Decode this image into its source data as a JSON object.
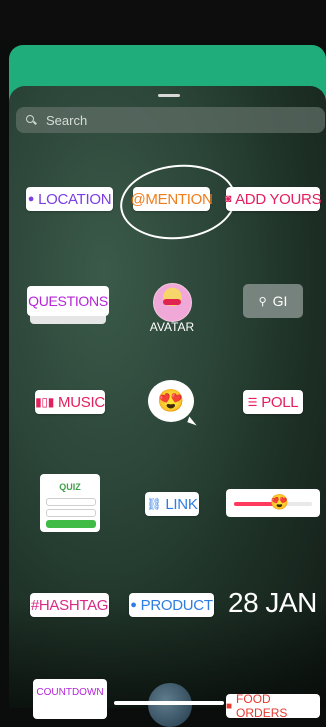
{
  "search": {
    "placeholder": "Search"
  },
  "stickers": {
    "location": "LOCATION",
    "mention": "@MENTION",
    "add_yours": "ADD YOURS",
    "questions": "QUESTIONS",
    "avatar": "AVATAR",
    "gif": "GI",
    "music": "MUSIC",
    "emoji_slider_emoji": "😍",
    "poll": "POLL",
    "quiz": "QUIZ",
    "link": "LINK",
    "hashtag": "#HASHTAG",
    "product": "PRODUCT",
    "date": "28 JAN",
    "countdown": "COUNTDOWN",
    "food_orders": "FOOD ORDERS"
  },
  "slider_level": 0.58,
  "colors": {
    "location": "#7b3fe4",
    "mention": "#f07d1c",
    "add_yours": "#e3205f",
    "questions": "#b426d6",
    "music": "#e3205f",
    "poll": "#e3205f",
    "link": "#2f7de1",
    "hashtag": "#d82b86",
    "product": "#2f7de1",
    "green_card": "#1fae7b"
  },
  "icons": [
    "search-icon",
    "location-pin-icon",
    "camera-icon",
    "music-bars-icon",
    "poll-lines-icon",
    "link-icon",
    "product-bag-icon",
    "gif-search-icon"
  ]
}
